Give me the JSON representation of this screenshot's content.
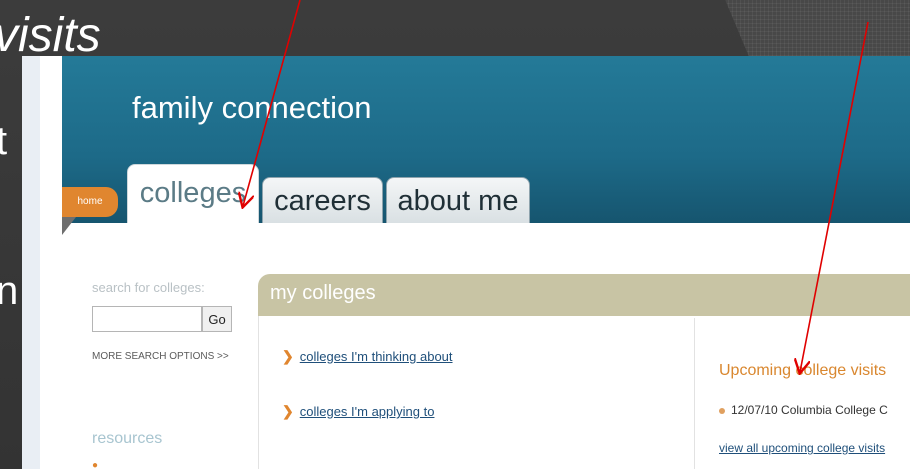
{
  "slide": {
    "title": "visits",
    "text_line_1": "t",
    "text_line_2": "n"
  },
  "app": {
    "brand": "family connection",
    "home_label": "home",
    "tabs": [
      {
        "label": "colleges",
        "active": true
      },
      {
        "label": "careers",
        "active": false
      },
      {
        "label": "about me",
        "active": false
      }
    ]
  },
  "sidebar": {
    "search_label": "search for colleges:",
    "search_value": "",
    "go_label": "Go",
    "more_options_label": "MORE SEARCH OPTIONS >>",
    "resources_heading": "resources"
  },
  "panel": {
    "title": "my colleges",
    "links": [
      {
        "label": "colleges I'm thinking about"
      },
      {
        "label": "colleges I'm applying to"
      }
    ],
    "upcoming": {
      "heading": "Upcoming college visits",
      "item": "12/07/10 Columbia College C",
      "view_all": "view all upcoming college visits"
    }
  },
  "colors": {
    "banner": "#1d6a88",
    "accent_orange": "#e0862f",
    "panel_header": "#c8c4a4",
    "annotation_arrow": "#e00000"
  }
}
